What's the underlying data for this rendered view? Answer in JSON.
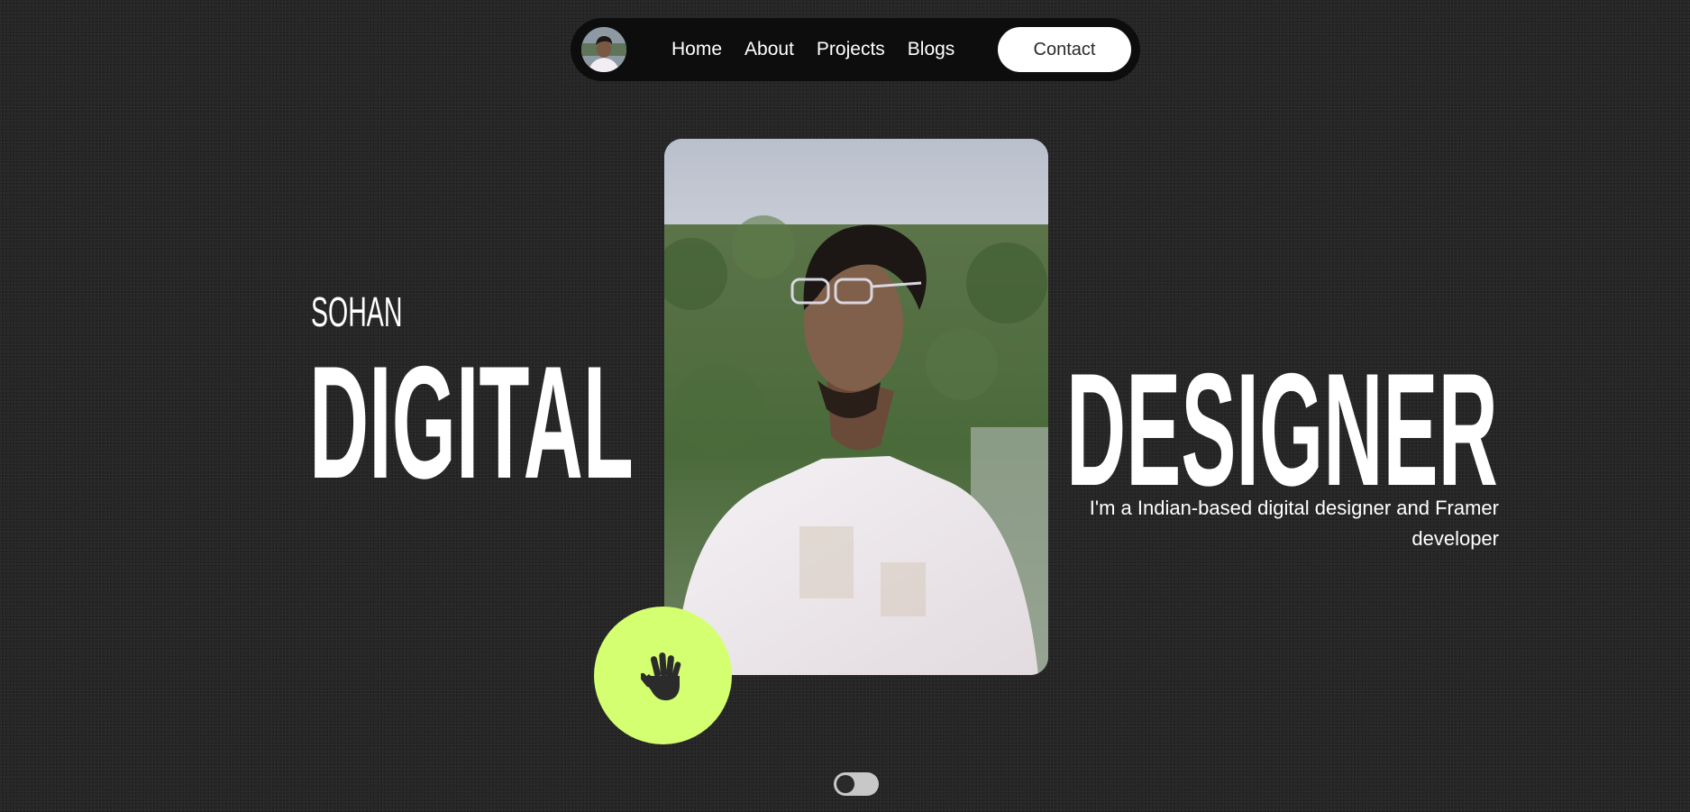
{
  "nav": {
    "links": [
      {
        "label": "Home"
      },
      {
        "label": "About"
      },
      {
        "label": "Projects"
      },
      {
        "label": "Blogs"
      }
    ],
    "contact_label": "Contact"
  },
  "hero": {
    "name": "SOHAN",
    "word_left": "DIGITAL",
    "word_right": "DESIGNER",
    "tagline": "I'm a Indian-based digital designer and Framer developer"
  },
  "wave_button": {
    "icon": "hand-wave-icon",
    "color": "#d4ff70"
  },
  "theme_toggle": {
    "state": "off"
  },
  "colors": {
    "background": "#252525",
    "nav_background": "#0d0d0d",
    "accent": "#d4ff70",
    "text": "#ffffff"
  }
}
